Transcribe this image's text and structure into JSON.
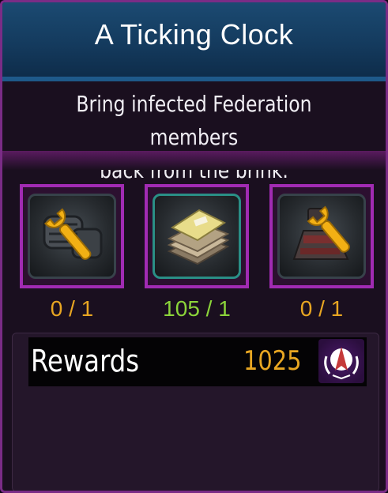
{
  "mission": {
    "title": "A Ticking Clock",
    "description_line1": "Bring infected Federation members",
    "description_line2": "back from the brink."
  },
  "slots": [
    {
      "icon": "armor-repair-icon",
      "count": "0 / 1",
      "color": "#e8a622"
    },
    {
      "icon": "documents-icon",
      "count": "105 / 1",
      "color": "#8bd43a"
    },
    {
      "icon": "turret-repair-icon",
      "count": "0 / 1",
      "color": "#e8a622"
    }
  ],
  "rewards": {
    "label": "Rewards",
    "value": "1025",
    "icon": "starfleet-insignia-icon"
  },
  "colors": {
    "accent_purple": "#a12bb3",
    "header_blue": "#1b4a72",
    "count_orange": "#e8a622",
    "count_green": "#8bd43a"
  }
}
